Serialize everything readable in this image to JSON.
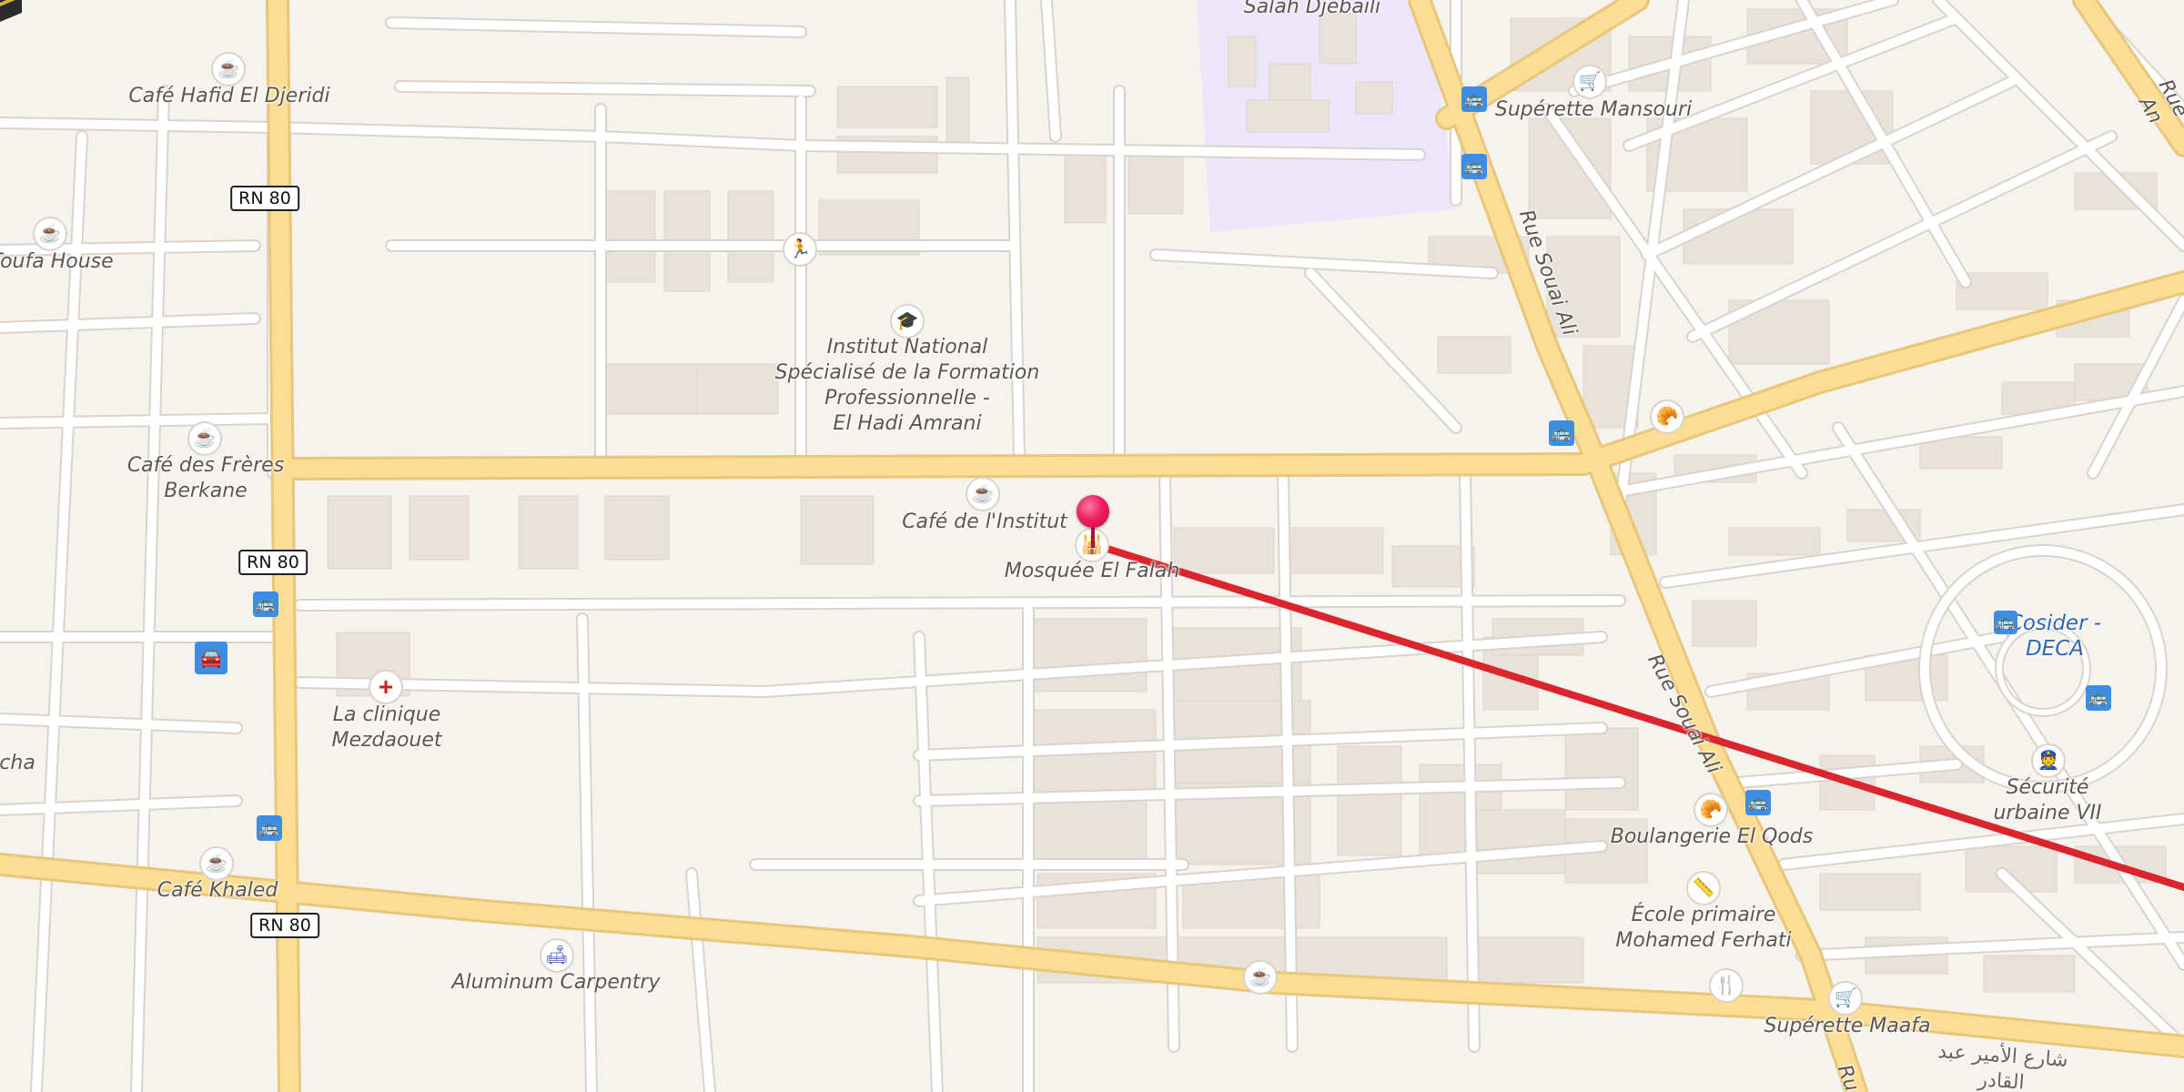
{
  "map": {
    "colors": {
      "background": "#f6f3ef",
      "major_road": "#fbdd94",
      "minor_road": "#ffffff",
      "building": "#e9e2da",
      "campus": "#ece6fb",
      "route_line": "#d9252b",
      "bus_stop": "#3d8ee2"
    },
    "route": {
      "from": "Mosquée El Falah",
      "to": "Kaaba (qibla direction)"
    },
    "road_labels": {
      "rn80_a": "RN 80",
      "rn80_b": "RN 80",
      "rn80_c": "RN 80",
      "rue_souai_ali_top": "Rue Souai Ali",
      "rue_souai_ali_mid": "Rue Souai Ali",
      "rue_souai_ali_bottom": "Ru",
      "rue_an": "Rue An",
      "arabic_street": "شارع الأمير عبد القادر"
    },
    "places": {
      "salah_djebaili": "Salah Djebaili",
      "cafe_hafid": "Café Hafid El Djeridi",
      "toufa_house": "Toufa House",
      "institut": "Institut National\nSpécialisé de la Formation\nProfessionnelle -\nEl Hadi Amrani",
      "cafe_freres": "Café des Frères\nBerkane",
      "cafe_institut": "Café de l'Institut",
      "mosquee": "Mosquée El Falah",
      "clinique": "La clinique\nMezdaouet",
      "aicha": "icha",
      "cafe_khaled": "Café Khaled",
      "aluminum": "Aluminum Carpentry",
      "superette_mansouri": "Supérette Mansouri",
      "cosider": "Cosider - DECA",
      "securite": "Sécurité urbaine VII",
      "boulangerie": "Boulangerie El Qods",
      "ecole": "École primaire\nMohamed Ferhati",
      "superette_maafa": "Supérette Maafa"
    },
    "icons": [
      "cafe-icon",
      "bakery-icon",
      "shop-icon",
      "school-icon",
      "clinic-icon",
      "sport-icon",
      "mosque-icon",
      "police-icon",
      "restaurant-icon",
      "bus-stop-icon",
      "parking-icon",
      "location-pin-icon",
      "kaaba-icon"
    ]
  }
}
